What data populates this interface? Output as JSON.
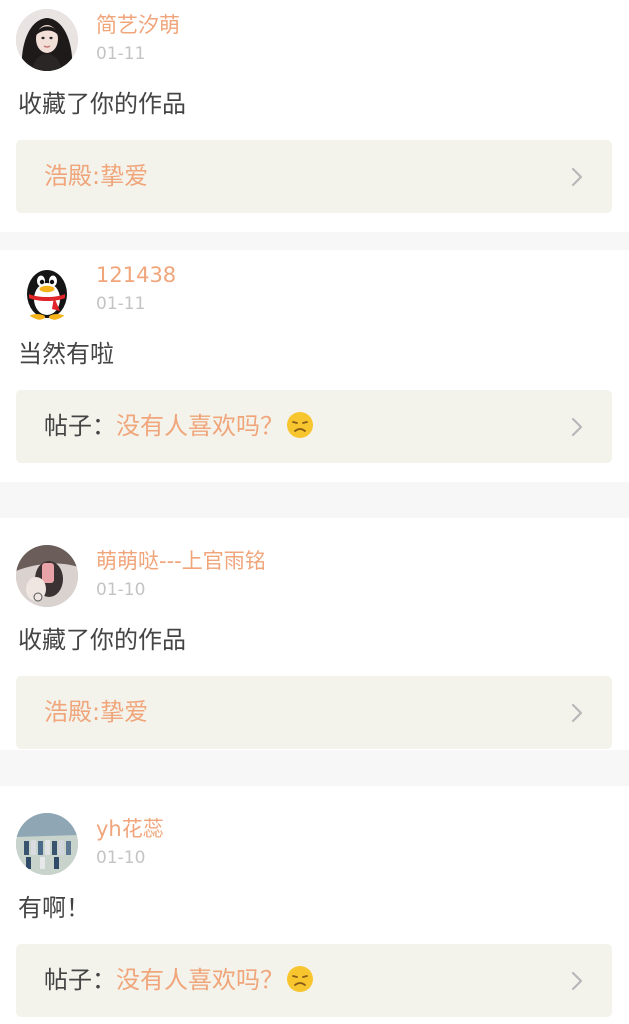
{
  "feed": [
    {
      "username": "简艺汐萌",
      "date": "01-11",
      "comment": "收藏了你的作品",
      "link": {
        "prefix": "",
        "title": "浩殿:挚爱",
        "emoji": ""
      },
      "avatar_icon": "portrait-avatar-icon"
    },
    {
      "username": "121438",
      "date": "01-11",
      "comment": "当然有啦",
      "link": {
        "prefix": "帖子：",
        "title": "没有人喜欢吗？",
        "emoji": "sad-face-emoji"
      },
      "avatar_icon": "qq-penguin-avatar-icon"
    },
    {
      "username": "萌萌哒---上官雨铭",
      "date": "01-10",
      "comment": "收藏了你的作品",
      "link": {
        "prefix": "",
        "title": "浩殿:挚爱",
        "emoji": ""
      },
      "avatar_icon": "photo-avatar-icon"
    },
    {
      "username": "yh花蕊",
      "date": "01-10",
      "comment": "有啊！",
      "link": {
        "prefix": "帖子：",
        "title": "没有人喜欢吗？",
        "emoji": "sad-face-emoji"
      },
      "avatar_icon": "group-photo-avatar-icon"
    }
  ],
  "colors": {
    "accent": "#f0a57a",
    "text": "#444444",
    "muted": "#c4c4c4",
    "card": "#f3f3ec",
    "divider": "#f7f7f7"
  }
}
